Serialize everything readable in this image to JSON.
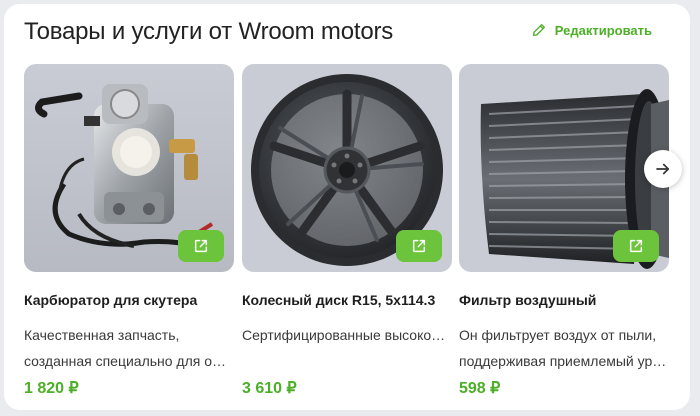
{
  "header": {
    "title": "Товары и услуги от Wroom motors",
    "edit_label": "Редактировать"
  },
  "colors": {
    "accent": "#4caf27",
    "button_green": "#6bc43c"
  },
  "products": [
    {
      "name": "Карбюратор для скутера",
      "desc_line1": "Качественная запчасть,",
      "desc_line2": "созданная специально для об…",
      "price": "1 820 ₽",
      "image": "carburetor"
    },
    {
      "name": "Колесный диск R15, 5x114.3",
      "desc_line1": "Сертифицированные высокоп…",
      "desc_line2": "",
      "price": "3 610 ₽",
      "image": "alloy-wheel"
    },
    {
      "name": "Фильтр воздушный",
      "desc_line1": "Он фильтрует воздух от пыли,",
      "desc_line2": "поддерживая приемлемый ур…",
      "price": "598 ₽",
      "image": "air-filter"
    }
  ],
  "icons": {
    "edit": "pencil-icon",
    "open": "external-link-icon",
    "next": "arrow-right-icon"
  }
}
